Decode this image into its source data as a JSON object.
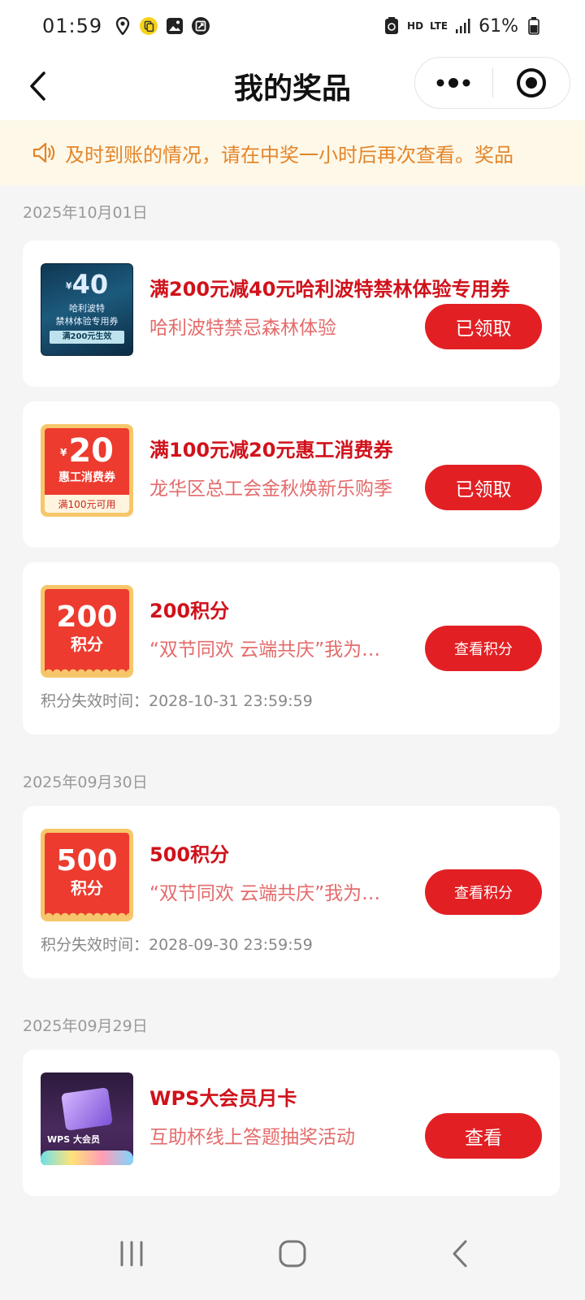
{
  "status_bar": {
    "time": "01:59",
    "hd": "HD",
    "lte": "LTE",
    "battery": "61%",
    "icons": [
      "location-icon",
      "app-notification-icon",
      "gallery-icon",
      "screenshot-icon",
      "recycle-icon",
      "signal-icon",
      "battery-icon"
    ]
  },
  "header": {
    "title": "我的奖品",
    "back_icon": "back-arrow-icon",
    "more_icon": "more-dots-icon",
    "close_icon": "target-close-icon"
  },
  "notice": {
    "icon": "speaker-icon",
    "text": "及时到账的情况，请在中奖一小时后再次查看。奖品"
  },
  "groups": [
    {
      "date": "2025年10月01日",
      "items": [
        {
          "thumb": {
            "amount": "40",
            "currency": "¥",
            "line1": "哈利波特",
            "line2": "禁林体验专用券",
            "strip": "满200元生效"
          },
          "title": "满200元减40元哈利波特禁林体验专用券",
          "subtitle": "哈利波特禁忌森林体验",
          "button": "已领取"
        },
        {
          "thumb": {
            "amount": "20",
            "currency": "¥",
            "name": "惠工消费券",
            "strip": "满100元可用"
          },
          "title": "满100元减20元惠工消费券",
          "subtitle": "龙华区总工会金秋焕新乐购季",
          "button": "已领取"
        },
        {
          "thumb": {
            "amount": "200",
            "unit": "积分"
          },
          "title": "200积分",
          "subtitle": "“双节同欢 云端共庆”我为…",
          "button": "查看积分",
          "expire": "积分失效时间：2028-10-31 23:59:59"
        }
      ]
    },
    {
      "date": "2025年09月30日",
      "items": [
        {
          "thumb": {
            "amount": "500",
            "unit": "积分"
          },
          "title": "500积分",
          "subtitle": "“双节同欢 云端共庆”我为…",
          "button": "查看积分",
          "expire": "积分失效时间：2028-09-30 23:59:59"
        }
      ]
    },
    {
      "date": "2025年09月29日",
      "items": [
        {
          "thumb": {
            "label": "WPS 大会员"
          },
          "title": "WPS大会员月卡",
          "subtitle": "互助杯线上答题抽奖活动",
          "button": "查看"
        }
      ]
    }
  ],
  "nav_bar": {
    "icons": [
      "recent-apps-icon",
      "home-icon",
      "back-icon"
    ]
  },
  "colors": {
    "accent_red": "#e22024",
    "title_red": "#d0121b",
    "subtitle_red": "#e46b6b",
    "notice_bg": "#fef8e8",
    "notice_text": "#e3852a",
    "page_bg": "#f5f5f5"
  }
}
